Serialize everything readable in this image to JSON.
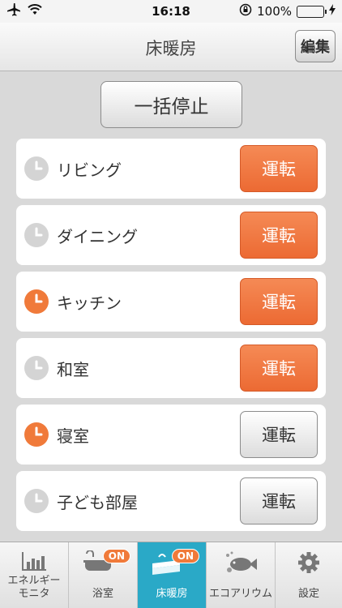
{
  "status_bar": {
    "time": "16:18",
    "battery_percent": "100%"
  },
  "nav": {
    "title": "床暖房",
    "edit_label": "編集"
  },
  "stop_all_label": "一括停止",
  "rooms": [
    {
      "name": "リビング",
      "timer_on": false,
      "run_label": "運転",
      "running": true
    },
    {
      "name": "ダイニング",
      "timer_on": false,
      "run_label": "運転",
      "running": true
    },
    {
      "name": "キッチン",
      "timer_on": true,
      "run_label": "運転",
      "running": true
    },
    {
      "name": "和室",
      "timer_on": false,
      "run_label": "運転",
      "running": true
    },
    {
      "name": "寝室",
      "timer_on": true,
      "run_label": "運転",
      "running": false
    },
    {
      "name": "子ども部屋",
      "timer_on": false,
      "run_label": "運転",
      "running": false
    }
  ],
  "tabs": [
    {
      "label_line1": "エネルギー",
      "label_line2": "モニタ",
      "icon": "bar-chart-icon",
      "badge": ""
    },
    {
      "label_line1": "浴室",
      "label_line2": "",
      "icon": "bathtub-icon",
      "badge": "ON"
    },
    {
      "label_line1": "床暖房",
      "label_line2": "",
      "icon": "floor-heating-icon",
      "badge": "ON",
      "selected": true
    },
    {
      "label_line1": "エコアリウム",
      "label_line2": "",
      "icon": "fish-icon",
      "badge": ""
    },
    {
      "label_line1": "設定",
      "label_line2": "",
      "icon": "gear-icon",
      "badge": ""
    }
  ],
  "colors": {
    "accent_orange": "#f07a3a",
    "tab_selected": "#2aa9c7",
    "battery_green": "#2fc62f"
  }
}
